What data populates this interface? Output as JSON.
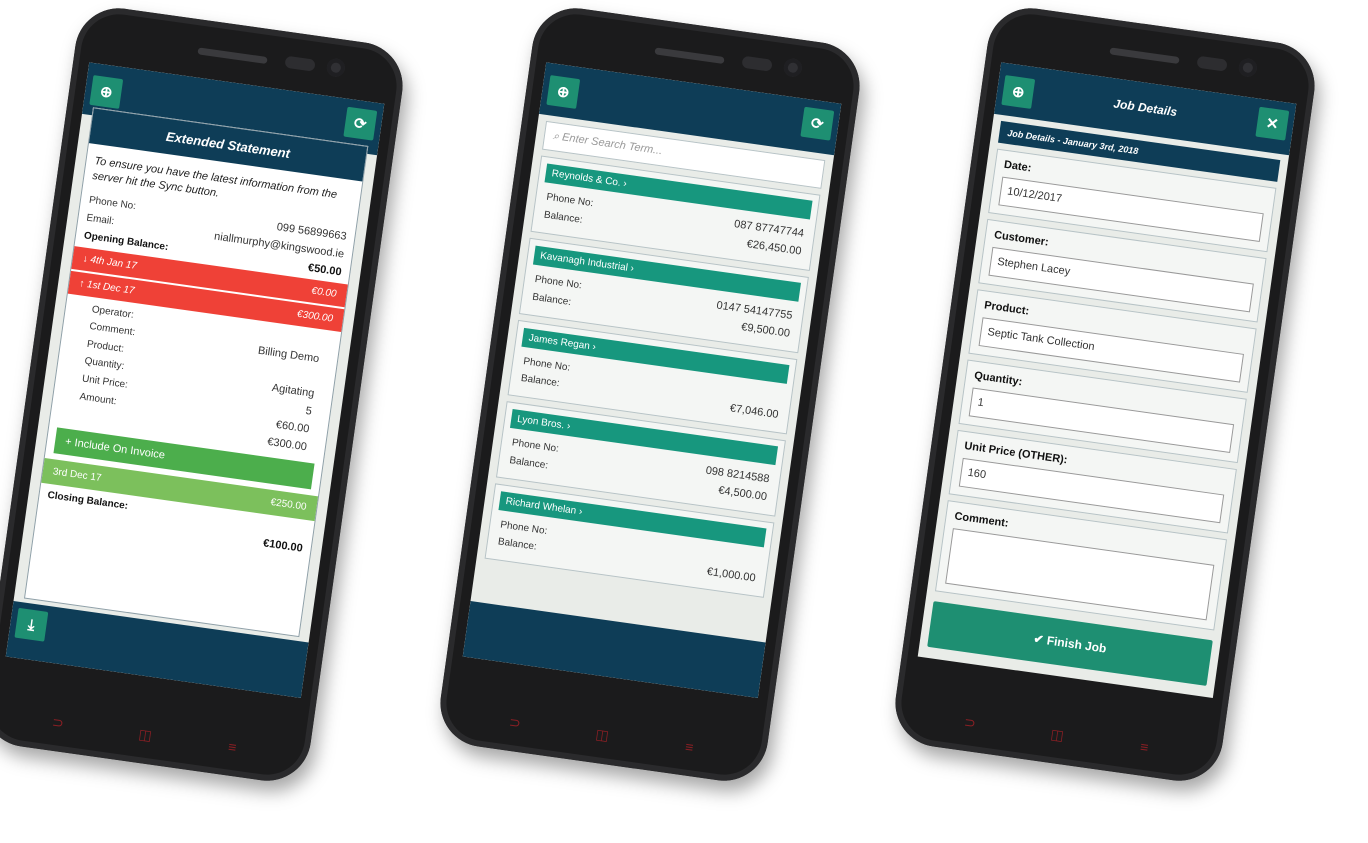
{
  "phone1": {
    "header_title": "Extended Statement",
    "sync_note": "To ensure you have the latest information from the server hit the Sync button.",
    "phone_label": "Phone No:",
    "phone_value": "099 56899663",
    "email_label": "Email:",
    "email_value": "niallmurphy@kingswood.ie",
    "opening_label": "Opening Balance:",
    "opening_value": "€50.00",
    "entries": [
      {
        "date": "4th Jan 17",
        "amount": "€0.00"
      },
      {
        "date": "1st Dec 17",
        "amount": "€300.00"
      }
    ],
    "details": [
      {
        "label": "Operator:",
        "value": ""
      },
      {
        "label": "Comment:",
        "value": "Billing Demo"
      },
      {
        "label": "Product:",
        "value": ""
      },
      {
        "label": "Quantity:",
        "value": "Agitating"
      },
      {
        "label": "Unit Price:",
        "value": "5"
      },
      {
        "label": "Amount:",
        "value": "€60.00"
      },
      {
        "label": "",
        "value": "€300.00"
      }
    ],
    "include_button": "Include On Invoice",
    "third_entry": {
      "date": "3rd Dec 17",
      "amount": "€250.00"
    },
    "closing_label": "Closing Balance:",
    "closing_value": "€100.00"
  },
  "phone2": {
    "search_placeholder": "Enter Search Term...",
    "customers": [
      {
        "name": "Reynolds & Co.",
        "phone_label": "Phone No:",
        "phone": "087 87747744",
        "balance_label": "Balance:",
        "balance": "€26,450.00"
      },
      {
        "name": "Kavanagh Industrial",
        "phone_label": "Phone No:",
        "phone": "0147 54147755",
        "balance_label": "Balance:",
        "balance": "€9,500.00"
      },
      {
        "name": "James Regan",
        "phone_label": "Phone No:",
        "phone": "",
        "balance_label": "Balance:",
        "balance": "€7,046.00"
      },
      {
        "name": "Lyon Bros.",
        "phone_label": "Phone No:",
        "phone": "098 8214588",
        "balance_label": "Balance:",
        "balance": "€4,500.00"
      },
      {
        "name": "Richard Whelan",
        "phone_label": "Phone No:",
        "phone": "",
        "balance_label": "Balance:",
        "balance": "€1,000.00"
      }
    ]
  },
  "phone3": {
    "title": "Job Details",
    "subheader": "Job Details - January 3rd, 2018",
    "fields": [
      {
        "label": "Date:",
        "value": "10/12/2017"
      },
      {
        "label": "Customer:",
        "value": "Stephen Lacey"
      },
      {
        "label": "Product:",
        "value": "Septic Tank Collection"
      },
      {
        "label": "Quantity:",
        "value": "1"
      },
      {
        "label": "Unit Price (OTHER):",
        "value": "160"
      },
      {
        "label": "Comment:",
        "value": ""
      }
    ],
    "finish_button": "Finish Job"
  },
  "colors": {
    "navy": "#0e3d57",
    "teal": "#1e8f72",
    "red": "#ef4137",
    "green": "#4cae4c"
  },
  "icons": [
    "plus-circle-icon",
    "refresh-icon",
    "close-icon",
    "download-icon",
    "chevron-right-icon",
    "search-icon",
    "check-icon",
    "arrow-down-icon",
    "arrow-up-icon"
  ]
}
